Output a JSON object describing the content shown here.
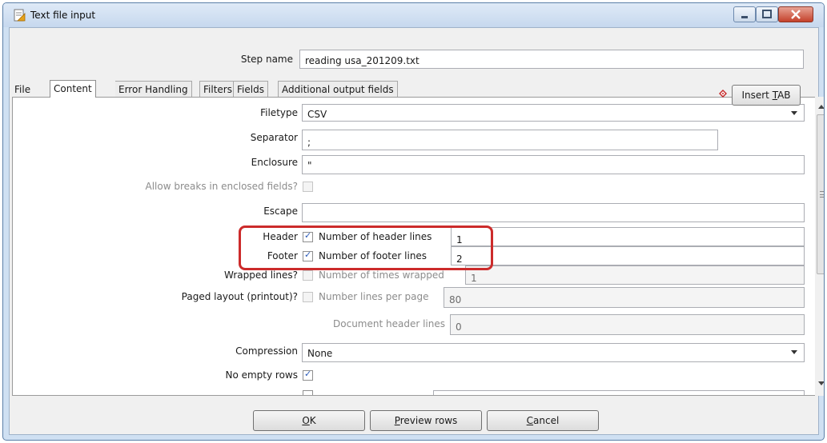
{
  "window": {
    "title": "Text file input"
  },
  "step_name": {
    "label": "Step name",
    "value": "reading usa_201209.txt"
  },
  "tabs": [
    {
      "label": "File"
    },
    {
      "label": "Content",
      "selected": true
    },
    {
      "label": "Error Handling"
    },
    {
      "label": "Filters"
    },
    {
      "label": "Fields"
    },
    {
      "label": "Additional output fields"
    }
  ],
  "content": {
    "filetype": {
      "label": "Filetype",
      "value": "CSV"
    },
    "separator": {
      "label": "Separator",
      "value": ";"
    },
    "insert_tab": {
      "pre": "Insert ",
      "accel": "T",
      "post": "AB"
    },
    "enclosure": {
      "label": "Enclosure",
      "value": "\""
    },
    "allow_breaks": {
      "label": "Allow breaks in enclosed fields?",
      "checked": false,
      "enabled": false
    },
    "escape": {
      "label": "Escape",
      "value": ""
    },
    "header": {
      "label": "Header",
      "checked": true,
      "lines_label": "Number of header lines",
      "lines_value": "1"
    },
    "footer": {
      "label": "Footer",
      "checked": true,
      "lines_label": "Number of footer lines",
      "lines_value": "2"
    },
    "wrapped": {
      "label": "Wrapped lines?",
      "checked": false,
      "times_label": "Number of times wrapped",
      "times_value": "1"
    },
    "paged": {
      "label": "Paged layout (printout)?",
      "checked": false,
      "lines_label": "Number lines per page",
      "lines_value": "80"
    },
    "doc_header": {
      "label": "Document header lines",
      "value": "0"
    },
    "compression": {
      "label": "Compression",
      "value": "None"
    },
    "no_empty_rows": {
      "label": "No empty rows",
      "checked": true
    }
  },
  "buttons": {
    "ok": {
      "accel": "O",
      "rest": "K"
    },
    "preview": {
      "accel": "P",
      "rest": "review rows"
    },
    "cancel": {
      "accel": "C",
      "rest": "ancel"
    }
  },
  "colors": {
    "highlight": "#cc2b2b",
    "check": "#2a5ab8",
    "titlebar": "#c6d8ee"
  }
}
